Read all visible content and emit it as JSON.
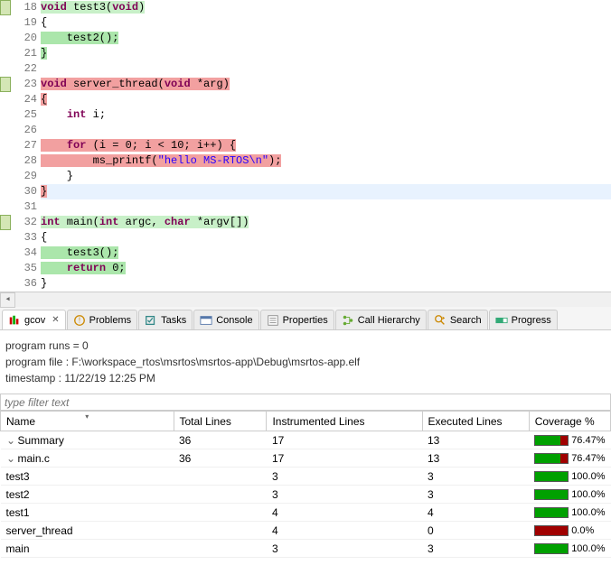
{
  "editor": {
    "lines": [
      {
        "n": 18,
        "marker": true,
        "hl": "green",
        "html": "<span class='kw'>void</span> test3(<span class='kw'>void</span>)"
      },
      {
        "n": 19,
        "marker": false,
        "hl": "",
        "html": "{"
      },
      {
        "n": 20,
        "marker": false,
        "hl": "greenh",
        "html": "    test2();"
      },
      {
        "n": 21,
        "marker": false,
        "hl": "greenh",
        "html": "}"
      },
      {
        "n": 22,
        "marker": false,
        "hl": "",
        "html": ""
      },
      {
        "n": 23,
        "marker": true,
        "hl": "red",
        "html": "<span class='kw'>void</span> server_thread(<span class='kw'>void</span> *arg)"
      },
      {
        "n": 24,
        "marker": false,
        "hl": "red",
        "html": "{",
        "tight": true
      },
      {
        "n": 25,
        "marker": false,
        "hl": "",
        "html": "    <span class='kw'>int</span> i;"
      },
      {
        "n": 26,
        "marker": false,
        "hl": "",
        "html": ""
      },
      {
        "n": 27,
        "marker": false,
        "hl": "red",
        "html": "    <span class='kw'>for</span> (i = 0; i &lt; 10; i++) {"
      },
      {
        "n": 28,
        "marker": false,
        "hl": "red",
        "html": "        ms_printf(<span class='str'>\"hello MS-RTOS\\n\"</span>);"
      },
      {
        "n": 29,
        "marker": false,
        "hl": "",
        "html": "    }"
      },
      {
        "n": 30,
        "marker": false,
        "hl": "cur",
        "html": "}",
        "redbrace": true
      },
      {
        "n": 31,
        "marker": false,
        "hl": "",
        "html": ""
      },
      {
        "n": 32,
        "marker": true,
        "hl": "green",
        "html": "<span class='kw'>int</span> main(<span class='kw'>int</span> argc, <span class='kw'>char</span> *argv[])"
      },
      {
        "n": 33,
        "marker": false,
        "hl": "",
        "html": "{"
      },
      {
        "n": 34,
        "marker": false,
        "hl": "greenh",
        "html": "    test3();"
      },
      {
        "n": 35,
        "marker": false,
        "hl": "greenh",
        "html": "    <span class='kw'>return</span> 0;"
      },
      {
        "n": 36,
        "marker": false,
        "hl": "",
        "html": "}"
      }
    ]
  },
  "tabs": [
    {
      "label": "gcov",
      "icon": "gcov",
      "active": true,
      "closable": true
    },
    {
      "label": "Problems",
      "icon": "problems",
      "active": false
    },
    {
      "label": "Tasks",
      "icon": "tasks",
      "active": false
    },
    {
      "label": "Console",
      "icon": "console",
      "active": false
    },
    {
      "label": "Properties",
      "icon": "properties",
      "active": false
    },
    {
      "label": "Call Hierarchy",
      "icon": "callh",
      "active": false
    },
    {
      "label": "Search",
      "icon": "search",
      "active": false
    },
    {
      "label": "Progress",
      "icon": "progress",
      "active": false
    }
  ],
  "info": {
    "runs_label": "program runs = 0",
    "file_label": "program file : F:\\workspace_rtos\\msrtos\\msrtos-app\\Debug\\msrtos-app.elf",
    "ts_label": "timestamp : 11/22/19 12:25 PM"
  },
  "filter_placeholder": "type filter text",
  "columns": {
    "name": "Name",
    "total": "Total Lines",
    "instr": "Instrumented Lines",
    "exec": "Executed Lines",
    "cov": "Coverage %"
  },
  "rows": [
    {
      "ind": 0,
      "tw": "v",
      "name": "Summary",
      "total": "36",
      "instr": "17",
      "exec": "13",
      "pct": "76.47%",
      "g": 76.47
    },
    {
      "ind": 1,
      "tw": "v",
      "name": "main.c",
      "total": "36",
      "instr": "17",
      "exec": "13",
      "pct": "76.47%",
      "g": 76.47
    },
    {
      "ind": 2,
      "tw": "",
      "name": "test3",
      "total": "",
      "instr": "3",
      "exec": "3",
      "pct": "100.0%",
      "g": 100
    },
    {
      "ind": 2,
      "tw": "",
      "name": "test2",
      "total": "",
      "instr": "3",
      "exec": "3",
      "pct": "100.0%",
      "g": 100
    },
    {
      "ind": 2,
      "tw": "",
      "name": "test1",
      "total": "",
      "instr": "4",
      "exec": "4",
      "pct": "100.0%",
      "g": 100
    },
    {
      "ind": 2,
      "tw": "",
      "name": "server_thread",
      "total": "",
      "instr": "4",
      "exec": "0",
      "pct": "0.0%",
      "g": 0
    },
    {
      "ind": 2,
      "tw": "",
      "name": "main",
      "total": "",
      "instr": "3",
      "exec": "3",
      "pct": "100.0%",
      "g": 100
    }
  ]
}
